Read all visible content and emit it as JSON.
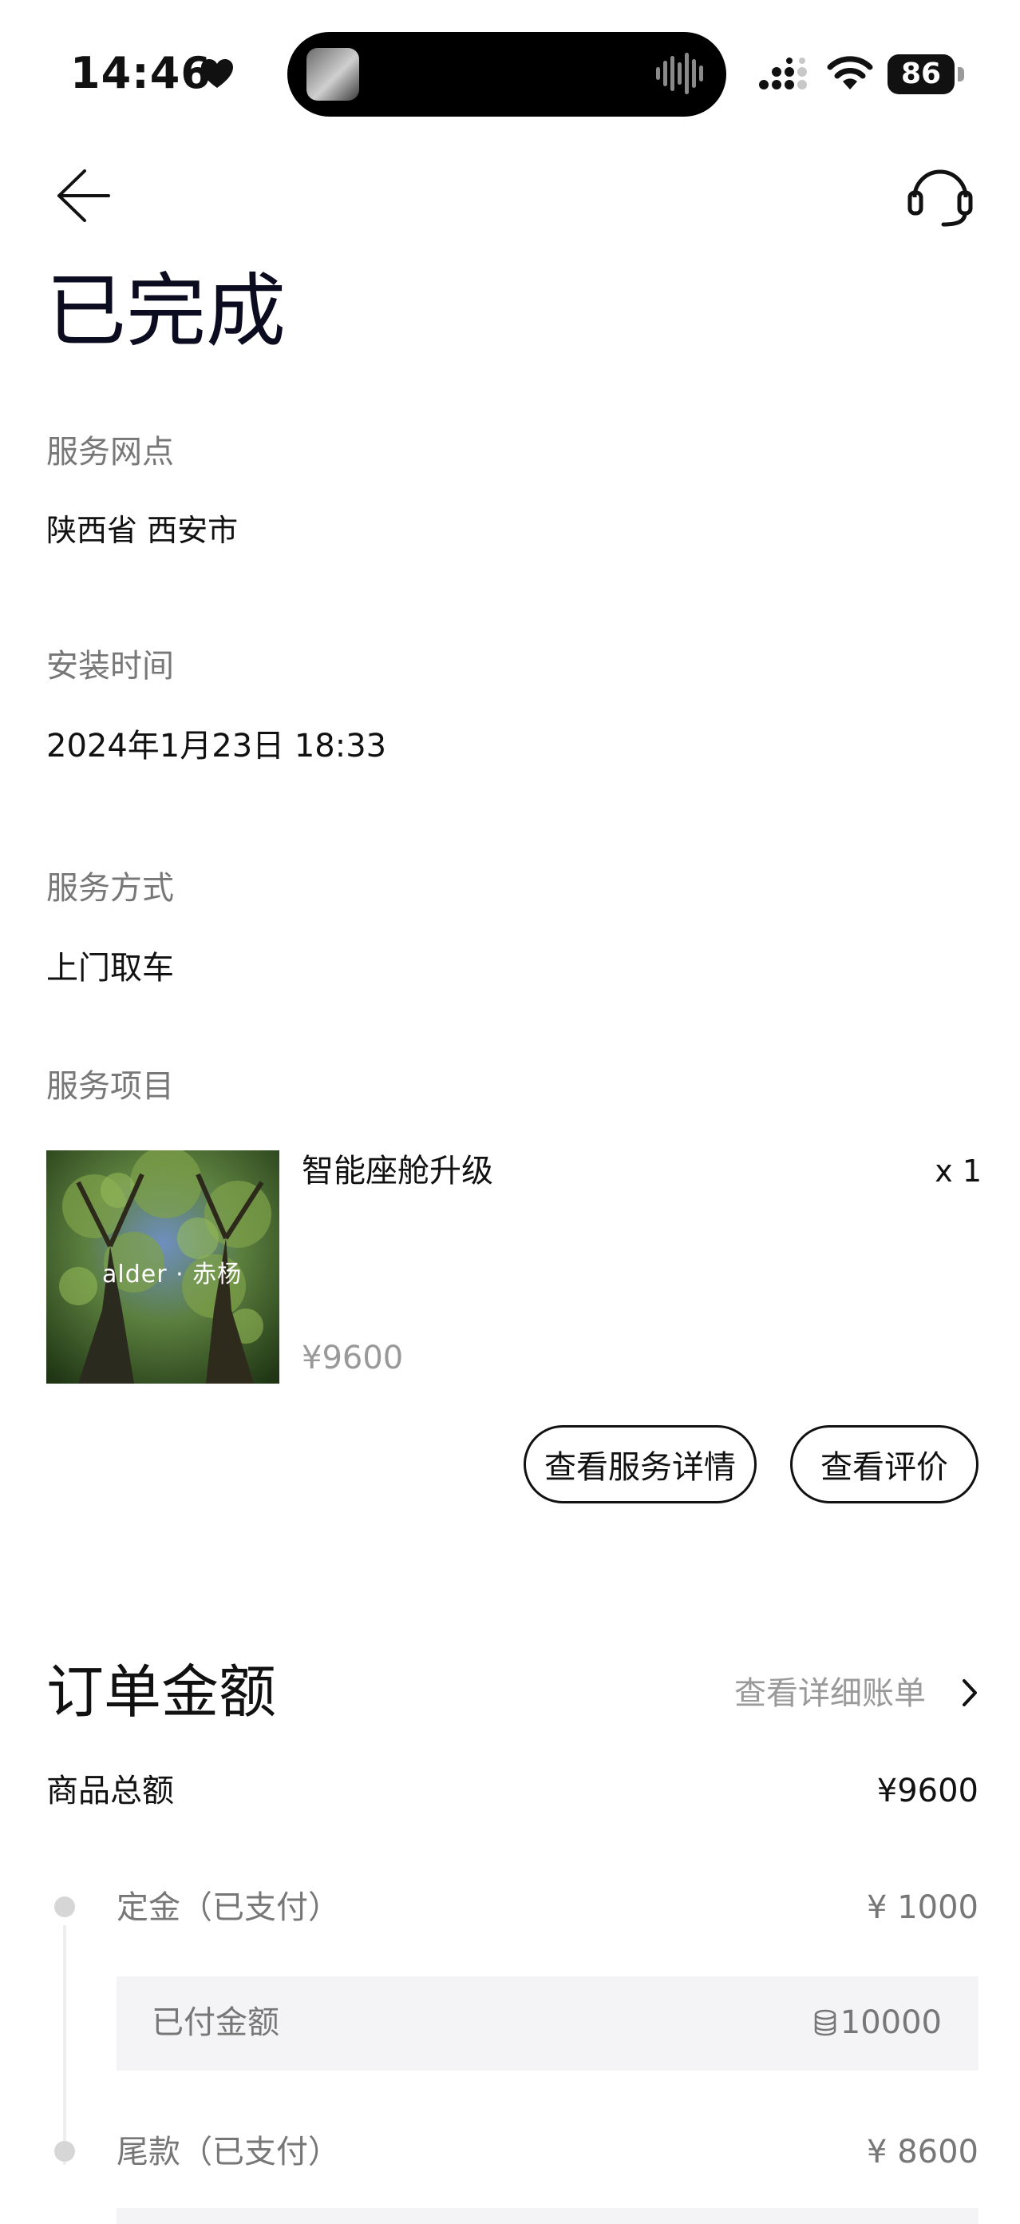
{
  "status_bar": {
    "time": "14:46",
    "battery": "86",
    "icons": [
      "heart-icon",
      "audio-wave-icon",
      "signal-icon",
      "wifi-icon",
      "battery-icon"
    ]
  },
  "header": {
    "title": "已完成",
    "icons": [
      "back-arrow-icon",
      "headset-support-icon"
    ]
  },
  "service_outlet": {
    "label": "服务网点",
    "value": "陕西省 西安市"
  },
  "install_time": {
    "label": "安装时间",
    "value": "2024年1月23日 18:33"
  },
  "service_method": {
    "label": "服务方式",
    "value": "上门取车"
  },
  "service_items": {
    "label": "服务项目",
    "item": {
      "name": "智能座舱升级",
      "quantity": "x 1",
      "price": "¥9600",
      "image_text": "alder · 赤杨"
    },
    "buttons": {
      "detail": "查看服务详情",
      "review": "查看评价"
    }
  },
  "order_amount": {
    "title": "订单金额",
    "bill_link": "查看详细账单",
    "goods_total": {
      "label": "商品总额",
      "value": "¥9600"
    },
    "deposit": {
      "label": "定金（已支付）",
      "value": "¥ 1000"
    },
    "paid": {
      "label": "已付金额",
      "value": "10000"
    },
    "final_payment": {
      "label": "尾款（已支付）",
      "value": "¥ 8600"
    }
  },
  "colors": {
    "text_primary": "#111111",
    "text_secondary": "#777777",
    "text_muted": "#999999",
    "box_background": "#f4f4f6"
  }
}
